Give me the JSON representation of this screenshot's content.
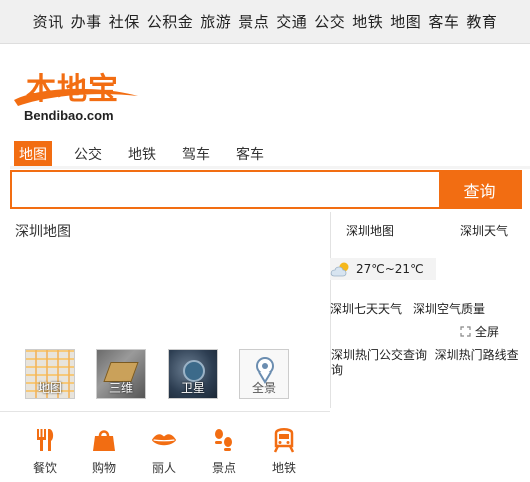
{
  "topnav": [
    "资讯",
    "办事",
    "社保",
    "公积金",
    "旅游",
    "景点",
    "交通",
    "公交",
    "地铁",
    "地图",
    "客车",
    "教育"
  ],
  "logo": {
    "cn": "本地宝",
    "en": "Bendibao.com"
  },
  "tabs": [
    "地图",
    "公交",
    "地铁",
    "驾车",
    "客车"
  ],
  "search": {
    "value": "",
    "placeholder": "",
    "button": "查询"
  },
  "map_title": "深圳地图",
  "map_types": [
    "地图",
    "三维",
    "卫星",
    "全景"
  ],
  "categories": [
    "餐饮",
    "购物",
    "丽人",
    "景点",
    "地铁"
  ],
  "side": {
    "map_link": "深圳地图",
    "weather_link": "深圳天气",
    "weather_temp": "27℃~21℃",
    "seven_day": "深圳七天天气",
    "air_quality": "深圳空气质量",
    "fullscreen": "全屏",
    "hot_bus": "深圳热门公交查询",
    "hot_road": "深圳热门路线查询"
  },
  "colors": {
    "accent": "#f26d12",
    "topnav_bg": "#f0f0f0"
  }
}
